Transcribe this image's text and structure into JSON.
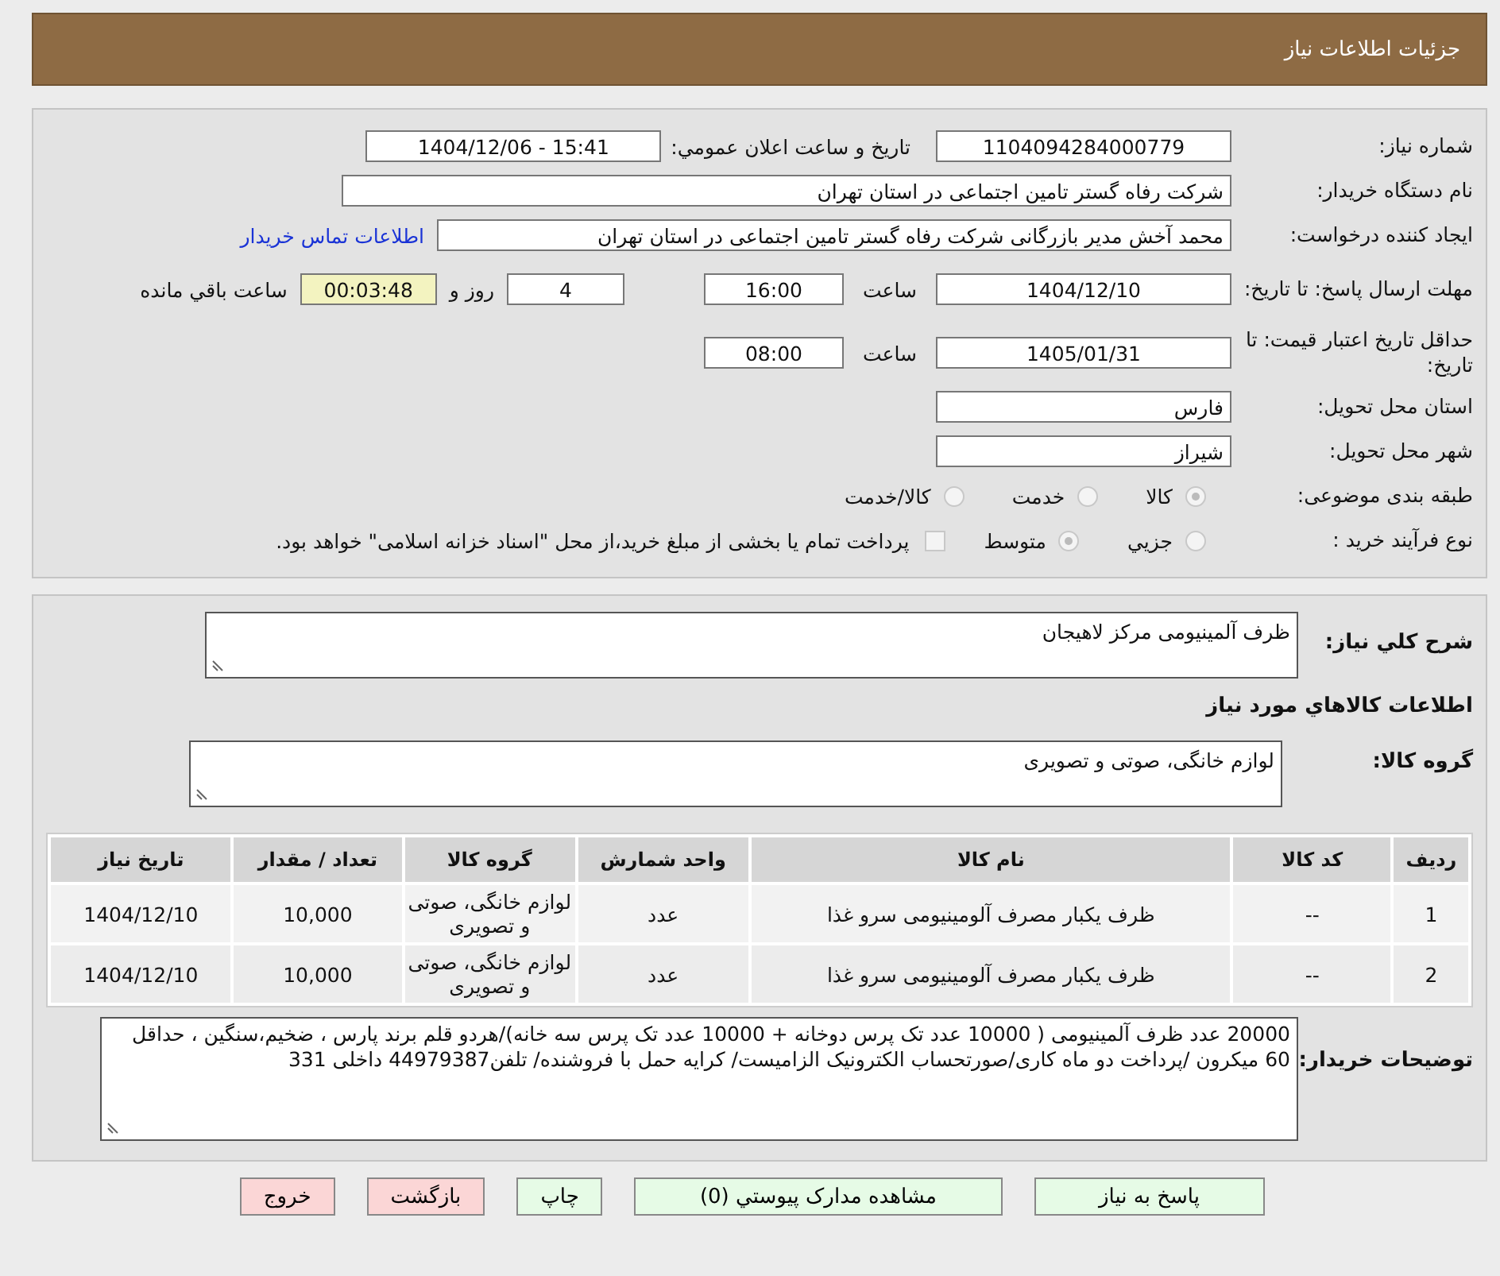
{
  "header": {
    "title": "جزئیات اطلاعات نیاز"
  },
  "need_number": {
    "label": "شماره نیاز:",
    "value": "1104094284000779"
  },
  "announce": {
    "label": "تاریخ و ساعت اعلان عمومي:",
    "value": "1404/12/06 - 15:41"
  },
  "buyer": {
    "label": "نام دستگاه خریدار:",
    "value": "شرکت رفاه گستر تامین اجتماعی در استان تهران"
  },
  "creator": {
    "label": "ایجاد کننده درخواست:",
    "value": "محمد آخش مدیر بازرگانی شرکت رفاه گستر تامین اجتماعی در استان تهران",
    "link": "اطلاعات تماس خریدار"
  },
  "deadline": {
    "label": "مهلت ارسال پاسخ: تا تاریخ:",
    "date": "1404/12/10",
    "time_label": "ساعت",
    "time": "16:00",
    "days": "4",
    "days_label": "روز و",
    "remaining": "00:03:48",
    "remaining_label": "ساعت باقي مانده"
  },
  "validity": {
    "label": "حداقل تاریخ اعتبار قیمت: تا تاریخ:",
    "date": "1405/01/31",
    "time_label": "ساعت",
    "time": "08:00"
  },
  "province": {
    "label": "استان محل تحویل:",
    "value": "فارس"
  },
  "city": {
    "label": "شهر محل تحویل:",
    "value": "شیراز"
  },
  "category": {
    "label": "طبقه بندی موضوعی:",
    "options": [
      {
        "label": "کالا",
        "selected": true
      },
      {
        "label": "خدمت",
        "selected": false
      },
      {
        "label": "کالا/خدمت",
        "selected": false
      }
    ]
  },
  "process": {
    "label": "نوع فرآیند خرید :",
    "options": [
      {
        "label": "جزيي",
        "selected": false
      },
      {
        "label": "متوسط",
        "selected": true
      }
    ],
    "treasury": {
      "label": "پرداخت تمام یا بخشی از مبلغ خرید،از محل \"اسناد خزانه اسلامی\" خواهد بود.",
      "checked": false
    }
  },
  "description": {
    "label": "شرح کلي نیاز:",
    "value": "ظرف آلمینیومی مرکز لاهیجان"
  },
  "goods_heading": "اطلاعات کالاهاي مورد نیاز",
  "goods_group": {
    "label": "گروه کالا:",
    "value": "لوازم خانگی، صوتی و تصویری"
  },
  "table": {
    "columns": [
      "ردیف",
      "کد کالا",
      "نام کالا",
      "واحد شمارش",
      "گروه کالا",
      "تعداد / مقدار",
      "تاریخ نیاز"
    ],
    "rows": [
      [
        "1",
        "--",
        "ظرف یکبار مصرف آلومینیومی سرو غذا",
        "عدد",
        "لوازم خانگی، صوتی و تصویری",
        "10,000",
        "1404/12/10"
      ],
      [
        "2",
        "--",
        "ظرف یکبار مصرف آلومینیومی سرو غذا",
        "عدد",
        "لوازم خانگی، صوتی و تصویری",
        "10,000",
        "1404/12/10"
      ]
    ]
  },
  "buyer_notes": {
    "label": "توضیحات خریدار:",
    "value": "20000 عدد ظرف آلمینیومی ( 10000 عدد تک پرس دوخانه + 10000 عدد تک پرس سه خانه)/هردو قلم برند پارس ، ضخیم،سنگین ، حداقل 60 میکرون /پرداخت دو ماه کاری/صورتحساب الکترونیک الزامیست/ کرایه حمل با فروشنده/ تلفن44979387 داخلی 331"
  },
  "buttons": [
    {
      "label": "پاسخ به نیاز",
      "kind": "go"
    },
    {
      "label": "مشاهده مدارک پیوستي (0)",
      "kind": "go"
    },
    {
      "label": "چاپ",
      "kind": "go"
    },
    {
      "label": "بازگشت",
      "kind": "stop"
    },
    {
      "label": "خروج",
      "kind": "stop"
    }
  ]
}
